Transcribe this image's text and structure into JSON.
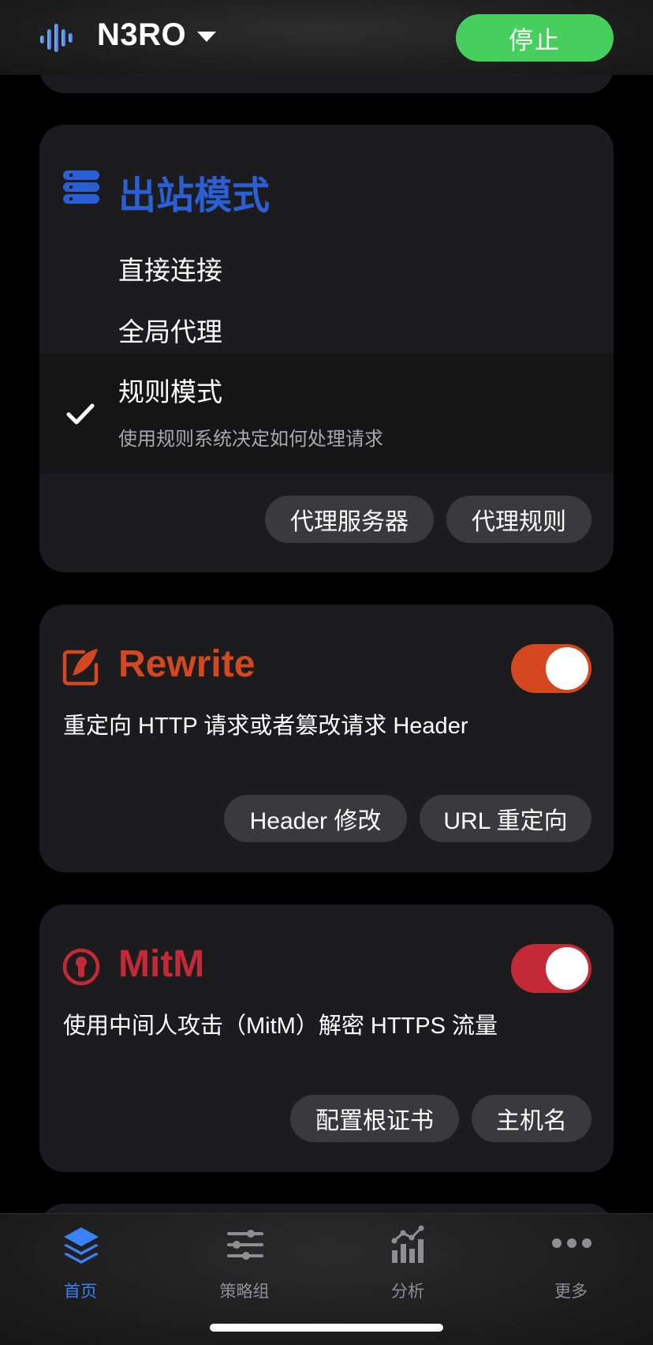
{
  "header": {
    "title": "N3RO",
    "stop_label": "停止"
  },
  "outbound": {
    "title": "出站模式",
    "accent": "#2a5fd6",
    "modes": [
      {
        "label": "直接连接"
      },
      {
        "label": "全局代理"
      },
      {
        "label": "规则模式",
        "description": "使用规则系统决定如何处理请求",
        "selected": true
      }
    ],
    "buttons": [
      "代理服务器",
      "代理规则"
    ]
  },
  "rewrite": {
    "title": "Rewrite",
    "accent": "#d4471f",
    "enabled": true,
    "description": "重定向 HTTP 请求或者篡改请求 Header",
    "buttons": [
      "Header 修改",
      "URL 重定向"
    ]
  },
  "mitm": {
    "title": "MitM",
    "accent": "#c42a35",
    "enabled": true,
    "description": "使用中间人攻击（MitM）解密 HTTPS 流量",
    "buttons": [
      "配置根证书",
      "主机名"
    ]
  },
  "tabs": [
    {
      "label": "首页",
      "icon": "layers-icon",
      "active": true
    },
    {
      "label": "策略组",
      "icon": "sliders-icon",
      "active": false
    },
    {
      "label": "分析",
      "icon": "chart-icon",
      "active": false
    },
    {
      "label": "更多",
      "icon": "more-icon",
      "active": false
    }
  ]
}
